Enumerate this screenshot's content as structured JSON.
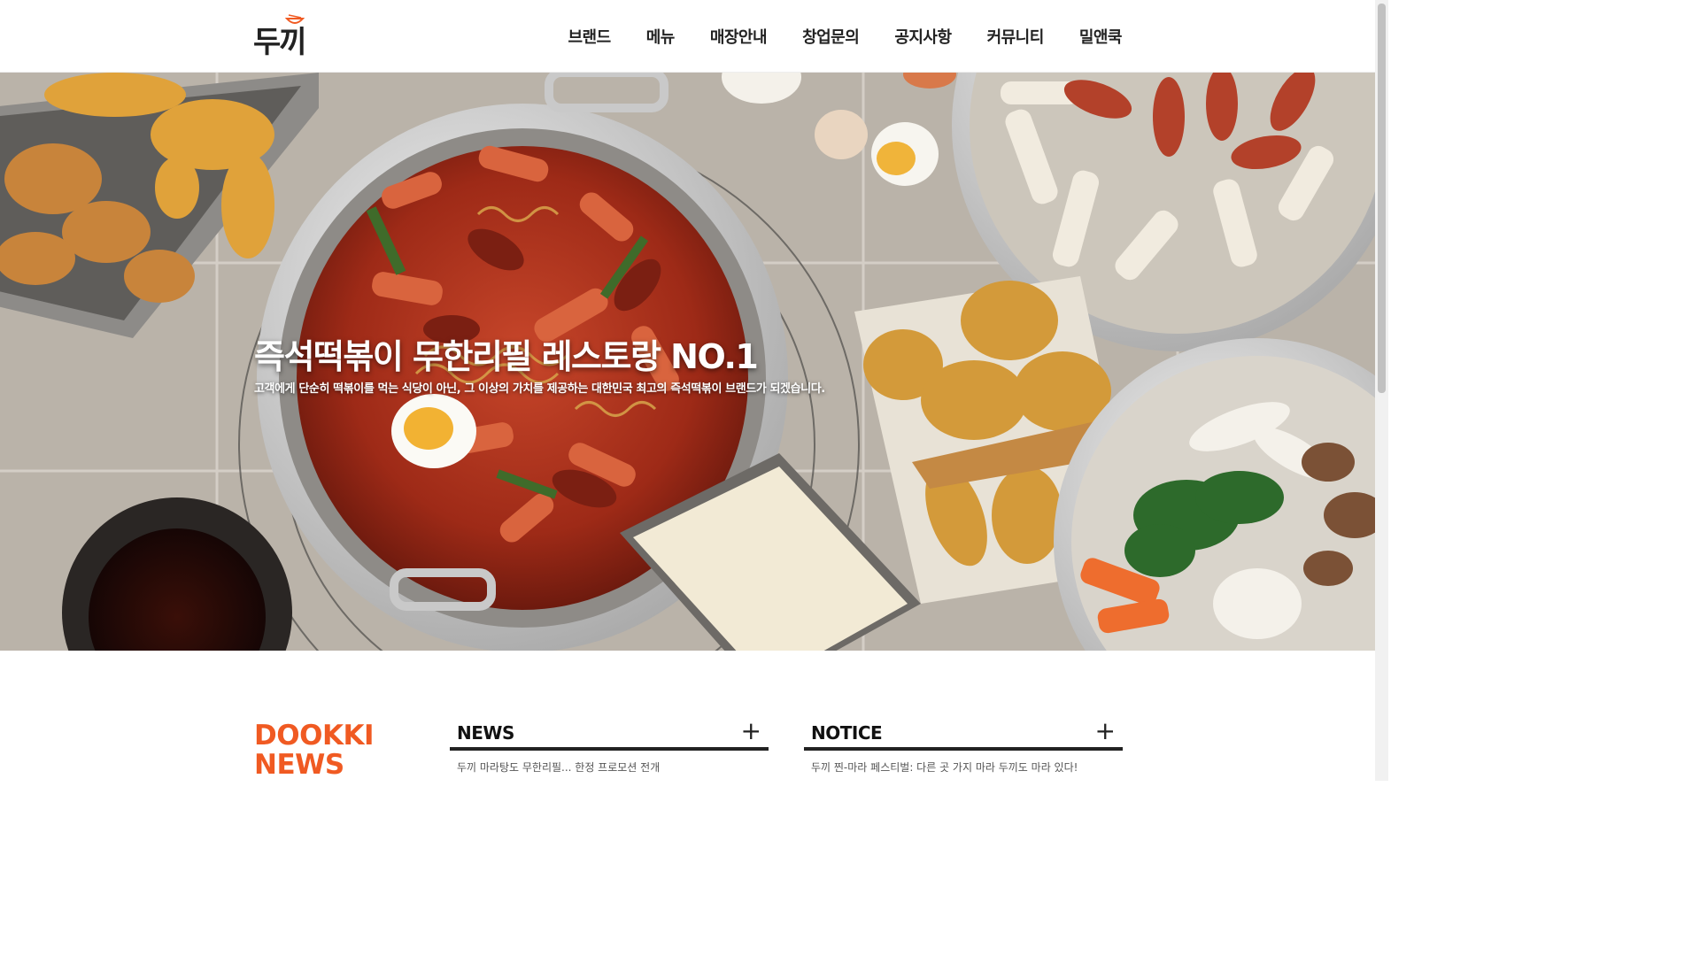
{
  "logo": {
    "text": "두끼"
  },
  "nav": {
    "items": [
      "브랜드",
      "메뉴",
      "매장안내",
      "창업문의",
      "공지사항",
      "커뮤니티",
      "밀앤쿡"
    ]
  },
  "hero": {
    "title": "즉석떡볶이 무한리필 레스토랑 NO.1",
    "subtitle": "고객에게 단순히 떡볶이를 먹는 식당이 아닌, 그 이상의 가치를 제공하는 대한민국 최고의 즉석떡볶이 브랜드가 되겠습니다."
  },
  "news_section": {
    "heading_line1": "DOOKKI",
    "heading_line2": "NEWS",
    "accent": "#f05a22",
    "boards": [
      {
        "title": "NEWS",
        "more": "+",
        "items": [
          "두끼 마라탕도 무한리필... 한정 프로모션 전개"
        ]
      },
      {
        "title": "NOTICE",
        "more": "+",
        "items": [
          "두끼 찐-마라 페스티벌: 다른 곳 가지 마라 두끼도 마라 있다!"
        ]
      }
    ]
  }
}
